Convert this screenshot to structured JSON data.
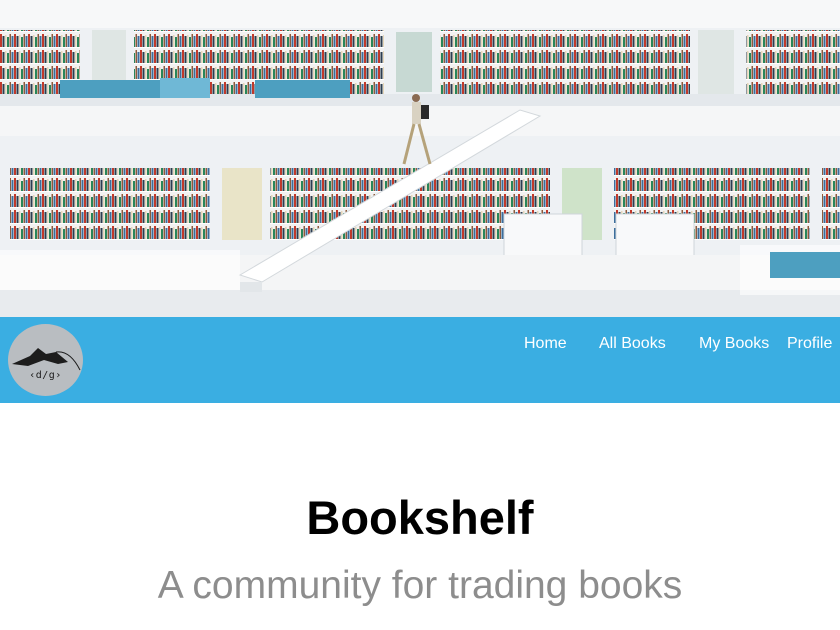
{
  "hero": {
    "image": "library-bookshelves-photo"
  },
  "nav": {
    "logo_text": "‹d/g›",
    "links": [
      "Home",
      "All Books",
      "My Books",
      "Profile"
    ],
    "bar_color": "#3aaee2"
  },
  "main": {
    "title": "Bookshelf",
    "subtitle": "A community for trading books"
  }
}
